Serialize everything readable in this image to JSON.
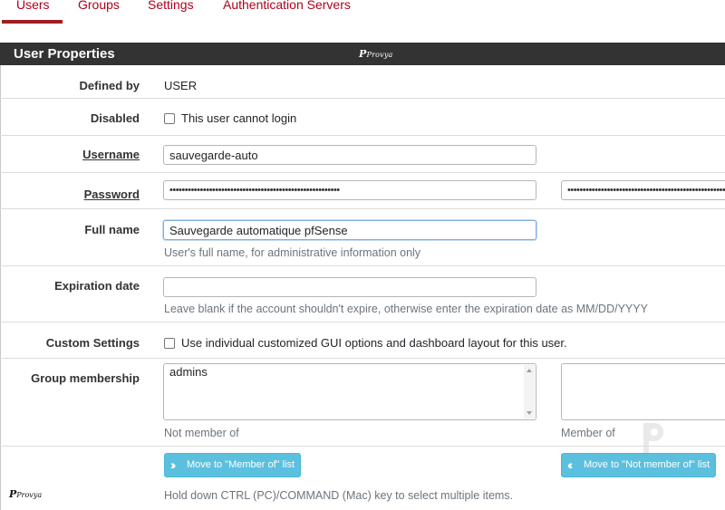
{
  "tabs": [
    {
      "label": "Users",
      "active": true
    },
    {
      "label": "Groups",
      "active": false
    },
    {
      "label": "Settings",
      "active": false
    },
    {
      "label": "Authentication Servers",
      "active": false
    }
  ],
  "panel": {
    "title": "User Properties",
    "watermark": "Provya"
  },
  "defined_by": {
    "label": "Defined by",
    "value": "USER"
  },
  "disabled": {
    "label": "Disabled",
    "checkbox_label": "This user cannot login",
    "checked": false
  },
  "username": {
    "label": "Username",
    "value": "sauvegarde-auto"
  },
  "password": {
    "label": "Password",
    "masked": "••••••••••••••••••••••••••••••••••••••••••••••••••••••••",
    "confirm_masked": "••••••••••••••••••••••••••••••••••••••••••••••••••••••••"
  },
  "full_name": {
    "label": "Full name",
    "value": "Sauvegarde automatique pfSense",
    "help": "User's full name, for administrative information only"
  },
  "expiration": {
    "label": "Expiration date",
    "value": "",
    "help": "Leave blank if the account shouldn't expire, otherwise enter the expiration date as MM/DD/YYYY"
  },
  "custom_settings": {
    "label": "Custom Settings",
    "checkbox_label": "Use individual customized GUI options and dashboard layout for this user.",
    "checked": false
  },
  "group_membership": {
    "label": "Group membership",
    "not_member_items": [
      "admins"
    ],
    "member_items": [],
    "not_member_caption": "Not member of",
    "member_caption": "Member of",
    "move_to_member_label": "Move to \"Member of\" list",
    "move_to_not_member_label": "Move to \"Not member of\" list",
    "help": "Hold down CTRL (PC)/COMMAND (Mac) key to select multiple items."
  },
  "footer_watermark": "Provya",
  "colors": {
    "accent": "#b0001b",
    "header_bg": "#333333",
    "button_info": "#5bc0de"
  }
}
